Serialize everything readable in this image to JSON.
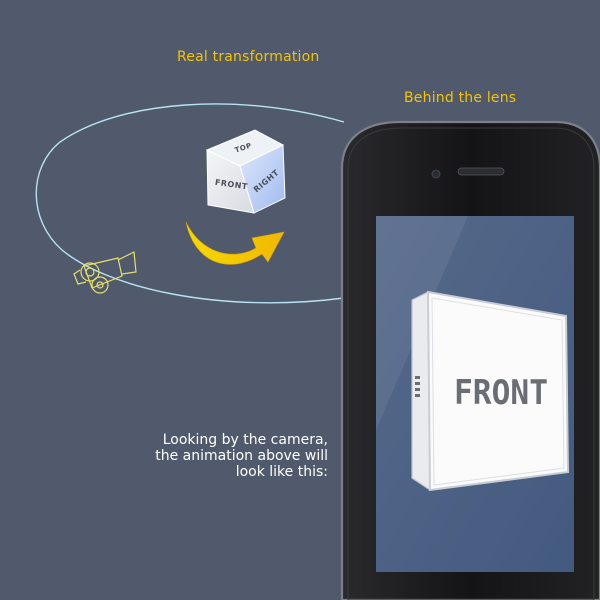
{
  "labels": {
    "real_transformation": "Real transformation",
    "behind_the_lens": "Behind the lens"
  },
  "caption": [
    "Looking by the camera,",
    "the animation above will",
    "look like this:"
  ],
  "cube_faces": {
    "top": "TOP",
    "front": "FRONT",
    "right": "RIGHT"
  },
  "screen_cube": {
    "front": "FRONT"
  },
  "icons": {
    "camera": "movie-camera-icon",
    "arrow": "curved-arrow-icon"
  },
  "colors": {
    "background": "#505a6c",
    "label": "#f4c400",
    "orbit": "#b8e2f4",
    "arrow": "#f5c800",
    "phone_body": "#1a1a1c",
    "phone_screen": "#4d6285",
    "camera_outline": "#e6e06a"
  }
}
